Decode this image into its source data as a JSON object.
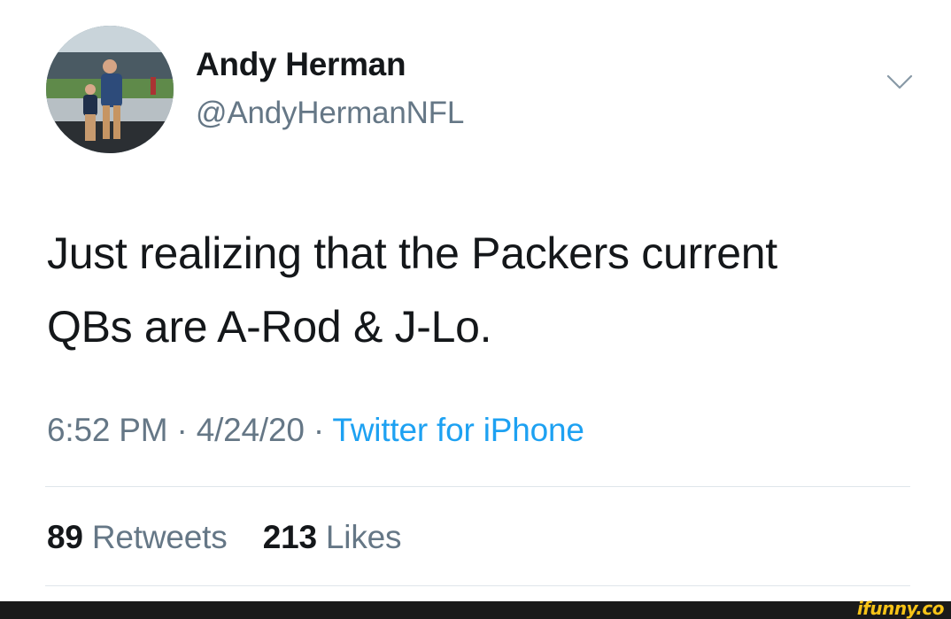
{
  "tweet": {
    "author": {
      "display_name": "Andy Herman",
      "handle": "@AndyHermanNFL"
    },
    "text_line1": "Just realizing that the Packers current",
    "text_line2": "QBs are A-Rod & J-Lo.",
    "time": "6:52 PM",
    "date": "4/24/20",
    "separator": "·",
    "source": "Twitter for iPhone",
    "retweets_count": "89",
    "retweets_label": "Retweets",
    "likes_count": "213",
    "likes_label": "Likes"
  },
  "icons": {
    "menu": "chevron-down-icon"
  },
  "watermark": {
    "text": "ifunny.co"
  },
  "colors": {
    "text_primary": "#14171a",
    "text_secondary": "#657786",
    "link": "#1da1f2",
    "divider": "#dfe5ea",
    "watermark": "#f7c317"
  }
}
